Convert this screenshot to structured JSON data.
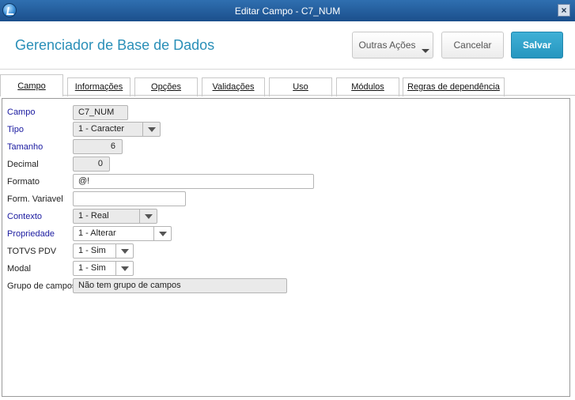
{
  "window": {
    "title": "Editar Campo - C7_NUM",
    "close_label": "×"
  },
  "header": {
    "title": "Gerenciador de Base de Dados",
    "outras_acoes": "Outras Ações",
    "cancelar": "Cancelar",
    "salvar": "Salvar"
  },
  "tabs": [
    {
      "label": "Campo"
    },
    {
      "label": "Informações"
    },
    {
      "label": "Opções"
    },
    {
      "label": "Validações"
    },
    {
      "label": "Uso"
    },
    {
      "label": "Módulos"
    },
    {
      "label": "Regras de dependência"
    }
  ],
  "form": {
    "campo": {
      "label": "Campo",
      "value": "C7_NUM"
    },
    "tipo": {
      "label": "Tipo",
      "value": "1 - Caracter"
    },
    "tamanho": {
      "label": "Tamanho",
      "value": "6"
    },
    "decimal": {
      "label": "Decimal",
      "value": "0"
    },
    "formato": {
      "label": "Formato",
      "value": "@!"
    },
    "form_variavel": {
      "label": "Form. Variavel",
      "value": ""
    },
    "contexto": {
      "label": "Contexto",
      "value": "1 - Real"
    },
    "propriedade": {
      "label": "Propriedade",
      "value": "1 - Alterar"
    },
    "totvs_pdv": {
      "label": "TOTVS PDV",
      "value": "1 - Sim"
    },
    "modal": {
      "label": "Modal",
      "value": "1 - Sim"
    },
    "grupo_campos": {
      "label": "Grupo de campos",
      "value": "Não tem grupo de campos"
    }
  },
  "colors": {
    "accent": "#2a8fb8",
    "save": "#2696bf",
    "required_label": "#1a1aa0",
    "titlebar": "#1b4f8c"
  }
}
